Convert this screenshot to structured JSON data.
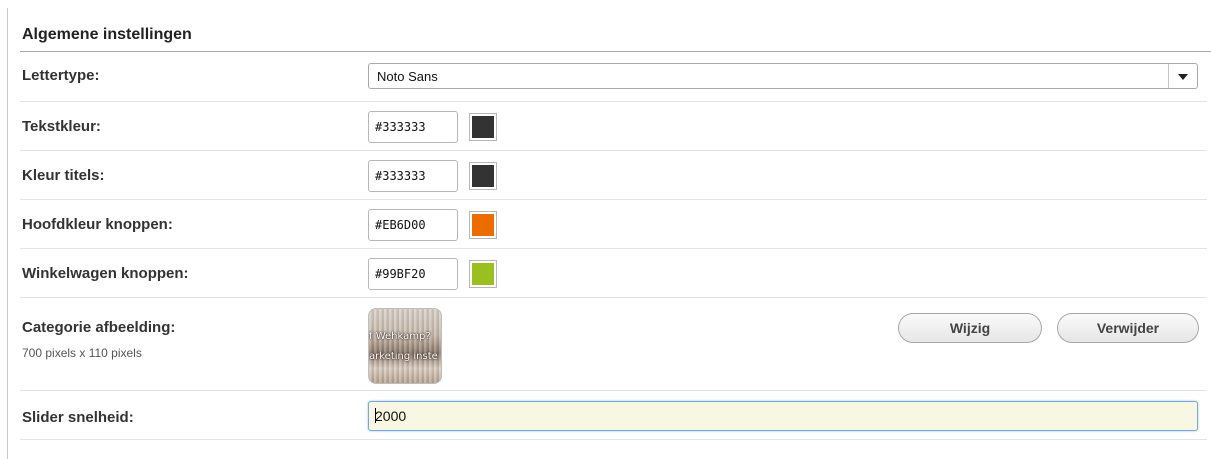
{
  "panel": {
    "title": "Algemene instellingen"
  },
  "font": {
    "label": "Lettertype:",
    "selected": "Noto Sans"
  },
  "colors": [
    {
      "label": "Tekstkleur:",
      "value": "#333333",
      "swatch": "#333333"
    },
    {
      "label": "Kleur titels:",
      "value": "#333333",
      "swatch": "#333333"
    },
    {
      "label": "Hoofdkleur knoppen:",
      "value": "#EB6D00",
      "swatch": "#EB6D00"
    },
    {
      "label": "Winkelwagen knoppen:",
      "value": "#99BF20",
      "swatch": "#99BF20"
    }
  ],
  "category_image": {
    "label": "Categorie afbeelding:",
    "dimensions": "700 pixels x 110 pixels",
    "thumb_line1": "f Wehkamp?",
    "thumb_line2": "arketing inste",
    "change_label": "Wijzig",
    "remove_label": "Verwijder"
  },
  "slider": {
    "label": "Slider snelheid:",
    "value": "2000"
  },
  "icons": {
    "dropdown": "chevron-down-icon"
  }
}
